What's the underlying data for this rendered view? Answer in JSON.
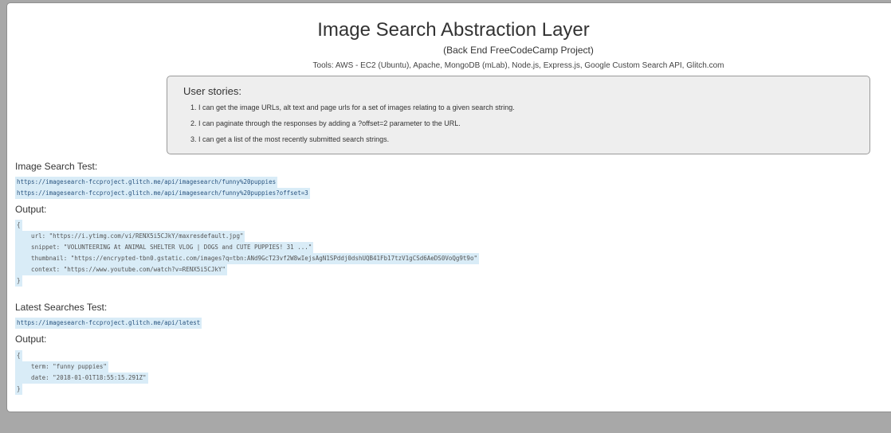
{
  "header": {
    "title": "Image Search Abstraction Layer",
    "subtitle": "(Back End FreeCodeCamp Project)",
    "tools": "Tools: AWS - EC2 (Ubuntu), Apache, MongoDB (mLab), Node.js, Express.js, Google Custom Search API, Glitch.com"
  },
  "stories": {
    "title": "User stories:",
    "items": [
      "I can get the image URLs, alt text and page urls for a set of images relating to a given search string.",
      "I can paginate through the responses by adding a ?offset=2 parameter to the URL.",
      "I can get a list of the most recently submitted search strings."
    ]
  },
  "image_search": {
    "label": "Image Search Test:",
    "urls": [
      "https://imagesearch-fccproject.glitch.me/api/imagesearch/funny%20puppies",
      "https://imagesearch-fccproject.glitch.me/api/imagesearch/funny%20puppies?offset=3"
    ],
    "output_label": "Output:",
    "output_lines": [
      "{",
      "    url: \"https://i.ytimg.com/vi/RENX5i5CJkY/maxresdefault.jpg\"",
      "    snippet: \"VOLUNTEERING At ANIMAL SHELTER VLOG | DOGS and CUTE PUPPIES! 31 ...\"",
      "    thumbnail: \"https://encrypted-tbn0.gstatic.com/images?q=tbn:ANd9GcT23vf2W8wIejsAgN1SPddj0dshUQB41Fb17tzV1gCSd6AeDS0VoQg9t9o\"",
      "    context: \"https://www.youtube.com/watch?v=RENX5i5CJkY\"",
      "}"
    ]
  },
  "latest_search": {
    "label": "Latest Searches Test:",
    "url": "https://imagesearch-fccproject.glitch.me/api/latest",
    "output_label": "Output:",
    "output_lines": [
      "{",
      "    term: \"funny puppies\"",
      "    date: \"2018-01-01T18:55:15.291Z\"",
      "}"
    ]
  }
}
